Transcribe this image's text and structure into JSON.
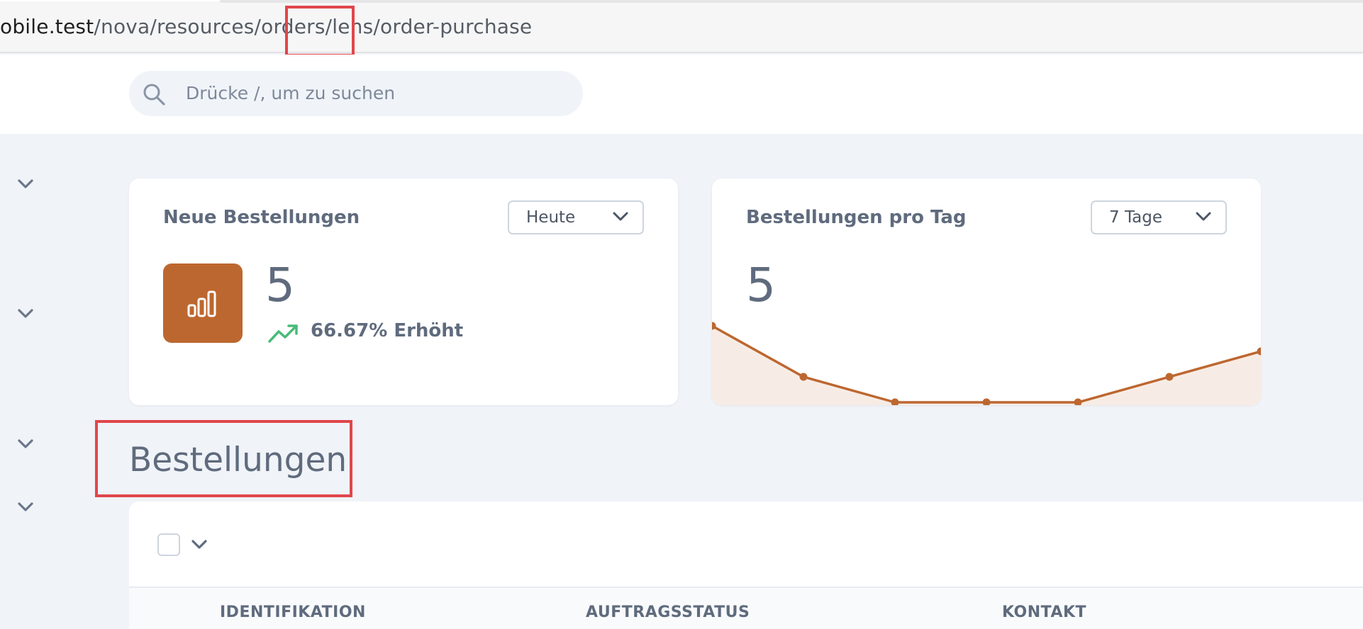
{
  "browser": {
    "url_host": "obile.test",
    "url_path": "/nova/resources/orders/lens/order-purchase"
  },
  "search": {
    "placeholder": "Drücke /, um zu suchen"
  },
  "metrics": [
    {
      "title": "Neue Bestellungen",
      "range_label": "Heute",
      "value": "5",
      "change_text": "66.67% Erhöht",
      "icon": "bar-chart-icon",
      "trend_icon": "trending-up-icon",
      "trend_color": "#48bb78"
    },
    {
      "title": "Bestellungen pro Tag",
      "range_label": "7 Tage",
      "value": "5",
      "sparkline": [
        5,
        3,
        2,
        2,
        2,
        3,
        4
      ]
    }
  ],
  "section": {
    "title": "Bestellungen"
  },
  "table": {
    "columns": [
      "IDENTIFIKATION",
      "AUFTRAGSSTATUS",
      "KONTAKT"
    ]
  },
  "colors": {
    "accent": "#bd6730",
    "background": "#f0f3f8",
    "highlight": "#e0464b"
  }
}
